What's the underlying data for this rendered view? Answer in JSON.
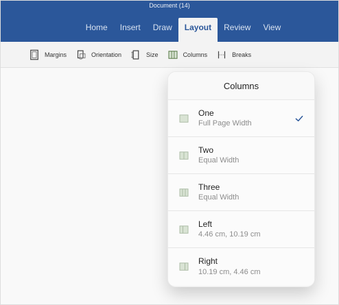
{
  "window": {
    "document_title": "Document (14)"
  },
  "tabs": [
    {
      "label": "Home",
      "active": false
    },
    {
      "label": "Insert",
      "active": false
    },
    {
      "label": "Draw",
      "active": false
    },
    {
      "label": "Layout",
      "active": true
    },
    {
      "label": "Review",
      "active": false
    },
    {
      "label": "View",
      "active": false
    }
  ],
  "toolbar": {
    "items": [
      {
        "label": "Margins",
        "icon": "margins-icon"
      },
      {
        "label": "Orientation",
        "icon": "orientation-icon"
      },
      {
        "label": "Size",
        "icon": "size-icon"
      },
      {
        "label": "Columns",
        "icon": "columns-icon"
      },
      {
        "label": "Breaks",
        "icon": "breaks-icon"
      }
    ]
  },
  "columns_popover": {
    "title": "Columns",
    "options": [
      {
        "title": "One",
        "subtitle": "Full Page Width",
        "selected": true
      },
      {
        "title": "Two",
        "subtitle": "Equal Width",
        "selected": false
      },
      {
        "title": "Three",
        "subtitle": "Equal Width",
        "selected": false
      },
      {
        "title": "Left",
        "subtitle": "4.46 cm, 10.19 cm",
        "selected": false
      },
      {
        "title": "Right",
        "subtitle": "10.19 cm, 4.46 cm",
        "selected": false
      }
    ]
  },
  "colors": {
    "ribbon_blue": "#2b579a",
    "checkmark_blue": "#2b579a"
  }
}
